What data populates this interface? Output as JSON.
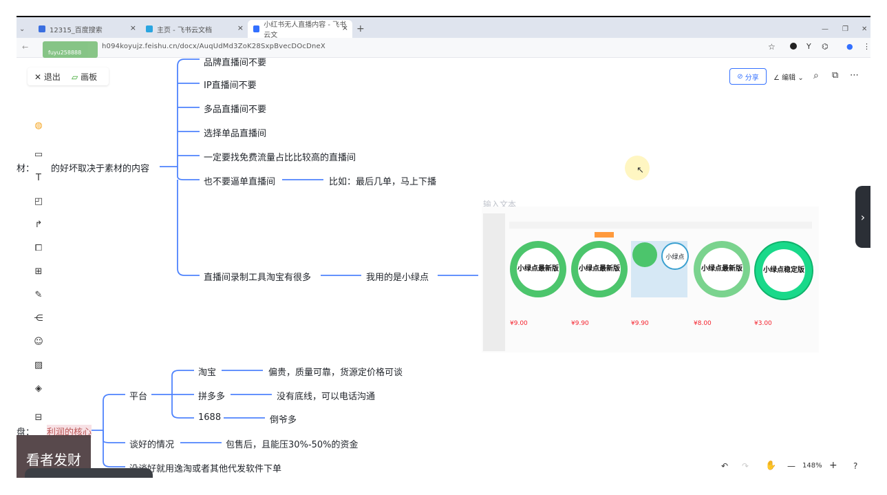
{
  "browser": {
    "tabs": [
      {
        "title": "12315_百度搜索",
        "close": "×"
      },
      {
        "title": "主页 - 飞书云文档",
        "close": "×"
      },
      {
        "title": "小红书无人直播内容 - 飞书云文",
        "close": "×"
      }
    ],
    "new_tab": "+",
    "window_controls": [
      "—",
      "❐",
      "✕"
    ],
    "url": "h094koyujz.feishu.cn/docx/AuqUdMd3ZoK28SxpBvecDOcDneX",
    "watermark_top": "fuyu258888"
  },
  "doc_toolbar": {
    "exit_label": "退出",
    "board_label": "画板",
    "share_label": "分享",
    "edit_label": "编辑"
  },
  "mindmap": {
    "root_left_prefix": "材：",
    "root_text": "的好坏取决于素材的内容",
    "branches": [
      {
        "label": "品牌直播间不要"
      },
      {
        "label": "IP直播间不要"
      },
      {
        "label": "多品直播间不要"
      },
      {
        "label": "选择单品直播间"
      },
      {
        "label": "一定要找免费流量占比比较高的直播间"
      },
      {
        "label": "也不要逼单直播间",
        "child": "比如：最后几单，马上下播"
      },
      {
        "label": "直播间录制工具淘宝有很多",
        "child": "我用的是小绿点"
      }
    ],
    "input_placeholder": "输入文本",
    "lower_root_prefix": "盘：",
    "lower_root_text": "利润的核心",
    "platform_label": "平台",
    "platforms": [
      {
        "name": "淘宝",
        "note": "偏贵，质量可靠，货源定价格可谈"
      },
      {
        "name": "拼多多",
        "note": "没有底线，可以电话沟通"
      },
      {
        "name": "1688",
        "note": "倒爷多"
      }
    ],
    "deal_label": "谈好的情况",
    "deal_note": "包售后，且能压30%-50%的资金",
    "fail_label": "没谈好就用逸淘或者其他代发软件下单"
  },
  "products": [
    {
      "title": "小绿点最新版",
      "price": "¥9.00"
    },
    {
      "title": "小绿点最新版",
      "price": "¥9.90"
    },
    {
      "title": "小绿点",
      "price": "¥9.90"
    },
    {
      "title": "小绿点最新版",
      "price": "¥8.00"
    },
    {
      "title": "小绿点稳定版",
      "price": "¥3.00"
    }
  ],
  "bottom_controls": {
    "zoom": "148%",
    "minus": "—",
    "plus": "+"
  },
  "watermark_text": "看者发财",
  "colors": {
    "accent": "#3370ff",
    "line": "#4e83fd",
    "product_green": "#4cc56c"
  }
}
